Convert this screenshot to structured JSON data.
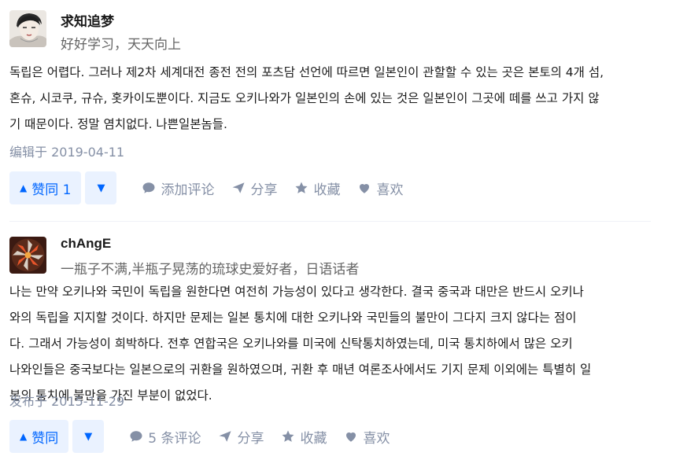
{
  "answers": [
    {
      "author_name": "求知追梦",
      "author_headline": "好好学习，天天向上",
      "content_lines": [
        "독립은 어렵다. 그러나 제2차 세계대전 종전 전의 포츠담 선언에 따르면 일본인이 관할할 수 있는 곳은 본토의 4개 섬,",
        "혼슈, 시코쿠, 규슈, 홋카이도뿐이다. 지금도 오키나와가 일본인의 손에 있는 것은 일본인이 그곳에 떼를 쓰고 가지 않",
        "기 때문이다. 정말 염치없다. 나쁜일본놈들."
      ],
      "timestamp": "编辑于 2019-04-11",
      "vote_label": "赞同 1",
      "comment_label": "添加评论",
      "share_label": "分享",
      "collect_label": "收藏",
      "like_label": "喜欢"
    },
    {
      "author_name": "chAngE",
      "author_headline": "一瓶子不满,半瓶子晃荡的琉球史爱好者，日语话者",
      "content_lines": [
        "나는 만약 오키나와 국민이 독립을 원한다면 여전히 가능성이 있다고 생각한다. 결국 중국과 대만은 반드시 오키나",
        "와의 독립을 지지할 것이다. 하지만 문제는 일본 통치에 대한 오키나와 국민들의 불만이 그다지 크지 않다는 점이",
        "다. 그래서 가능성이 희박하다. 전후 연합국은 오키나와를 미국에 신탁통치하였는데, 미국 통치하에서 많은 오키",
        "나와인들은 중국보다는 일본으로의 귀환을 원하였으며, 귀환 후 매년 여론조사에서도 기지 문제 이외에는 특별히 일",
        "본의 통치에 불만을 가진 부분이 없었다."
      ],
      "timestamp": "发布于 2015-11-29",
      "vote_label": "赞同",
      "comment_label": "5 条评论",
      "share_label": "分享",
      "collect_label": "收藏",
      "like_label": "喜欢"
    }
  ],
  "icons": {
    "vote_up": "triangle-up-icon",
    "vote_down": "triangle-down-icon",
    "comment": "comment-bubble-icon",
    "share": "paper-plane-icon",
    "collect": "star-icon",
    "like": "heart-icon"
  },
  "colors": {
    "accent": "#0066ff",
    "vote_bg": "#eaf2ff",
    "meta_gray": "#8590a6",
    "headline_gray": "#646464"
  }
}
